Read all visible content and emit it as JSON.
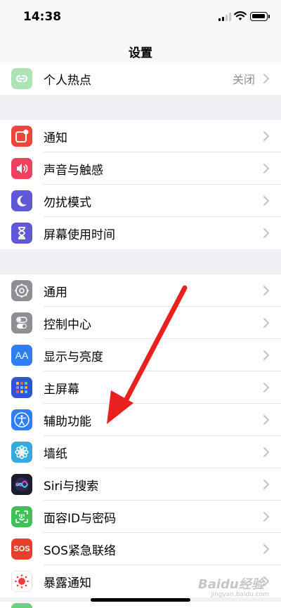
{
  "status": {
    "time": "14:38"
  },
  "nav": {
    "title": "设置"
  },
  "groups": [
    [
      {
        "label": "个人热点",
        "value": "关闭",
        "icon": "hotspot-icon",
        "color": "#aee3b5"
      }
    ],
    [
      {
        "label": "通知",
        "icon": "notifications-icon",
        "color": "#f0453a"
      },
      {
        "label": "声音与触感",
        "icon": "speaker-icon",
        "color": "#f0405f"
      },
      {
        "label": "勿扰模式",
        "icon": "moon-icon",
        "color": "#5f58d8"
      },
      {
        "label": "屏幕使用时间",
        "icon": "hourglass-icon",
        "color": "#5f58d8"
      }
    ],
    [
      {
        "label": "通用",
        "icon": "gear-icon",
        "color": "#8e8e93"
      },
      {
        "label": "控制中心",
        "icon": "toggles-icon",
        "color": "#8e8e93"
      },
      {
        "label": "显示与亮度",
        "icon": "display-aa-icon",
        "color": "#2f7ef6"
      },
      {
        "label": "主屏幕",
        "icon": "home-screen-grid-icon",
        "color": "#2f55d4"
      },
      {
        "label": "辅助功能",
        "icon": "accessibility-icon",
        "color": "#2f7ef6"
      },
      {
        "label": "墙纸",
        "icon": "flower-icon",
        "color": "#35aadc"
      },
      {
        "label": "Siri与搜索",
        "icon": "siri-icon",
        "color": "#1c1c2e"
      },
      {
        "label": "面容ID与密码",
        "icon": "face-id-icon",
        "color": "#3fc15a"
      },
      {
        "label": "SOS紧急联络",
        "icon": "sos-icon",
        "color": "#e8402f",
        "icon_text": "SOS"
      },
      {
        "label": "暴露通知",
        "icon": "exposure-icon",
        "color": "#ffffff"
      }
    ]
  ],
  "display_icon_text": "AA",
  "watermark": {
    "text": "Baidu经验",
    "sub": "jingyan.baidu.com"
  }
}
